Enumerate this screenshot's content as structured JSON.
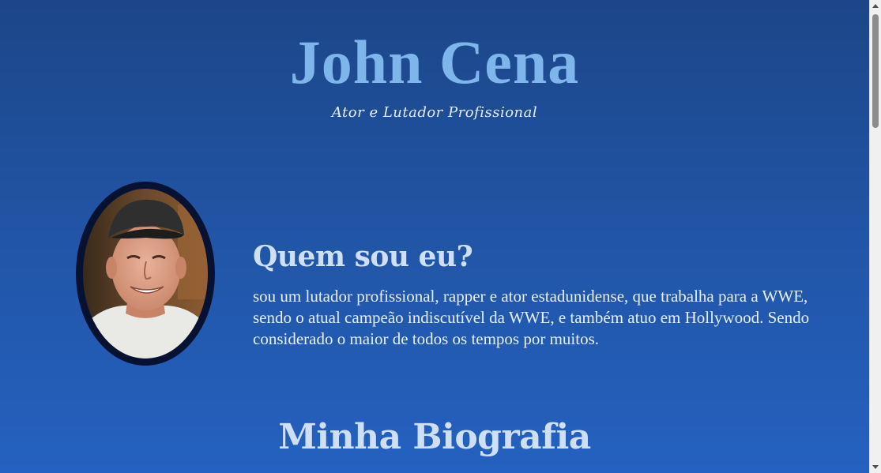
{
  "header": {
    "title": "John Cena",
    "subtitle": "Ator e Lutador Profissional"
  },
  "about": {
    "photo_alt": "Foto de John Cena",
    "heading": "Quem sou eu?",
    "text": "sou um lutador profissional, rapper e ator estadunidense, que trabalha para a WWE, sendo o atual campeão indiscutível da WWE, e também atuo em Hollywood. Sendo considerado o maior de todos os tempos por muitos."
  },
  "biography": {
    "heading": "Minha Biografia"
  },
  "colors": {
    "background_top": "#1c4688",
    "background_bottom": "#2561c0",
    "title": "#7eb5ea",
    "heading": "#cfe0f6",
    "photo_frame": "#071232"
  }
}
